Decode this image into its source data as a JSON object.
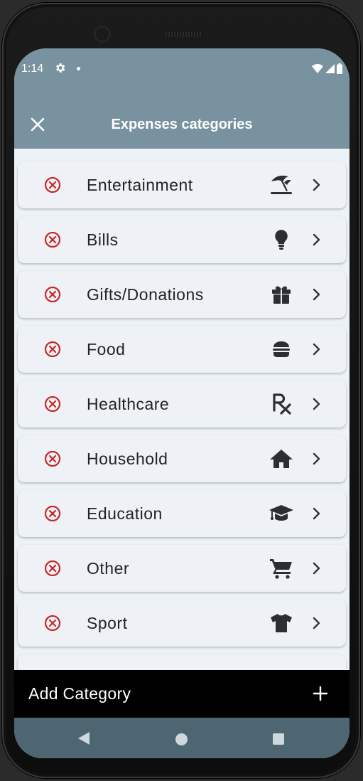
{
  "status": {
    "time": "1:14"
  },
  "appbar": {
    "title": "Expenses categories"
  },
  "categories": [
    {
      "label": "Entertainment",
      "icon": "beach-umbrella-icon"
    },
    {
      "label": "Bills",
      "icon": "lightbulb-icon"
    },
    {
      "label": "Gifts/Donations",
      "icon": "gift-icon"
    },
    {
      "label": "Food",
      "icon": "burger-icon"
    },
    {
      "label": "Healthcare",
      "icon": "prescription-icon"
    },
    {
      "label": "Household",
      "icon": "house-icon"
    },
    {
      "label": "Education",
      "icon": "graduation-cap-icon"
    },
    {
      "label": "Other",
      "icon": "shopping-cart-icon"
    },
    {
      "label": "Sport",
      "icon": "tshirt-icon"
    }
  ],
  "bottom": {
    "add_label": "Add Category"
  },
  "colors": {
    "appbar": "#78939f",
    "delete": "#c62828",
    "navbar": "#4e6672",
    "card": "#eef2f6"
  }
}
